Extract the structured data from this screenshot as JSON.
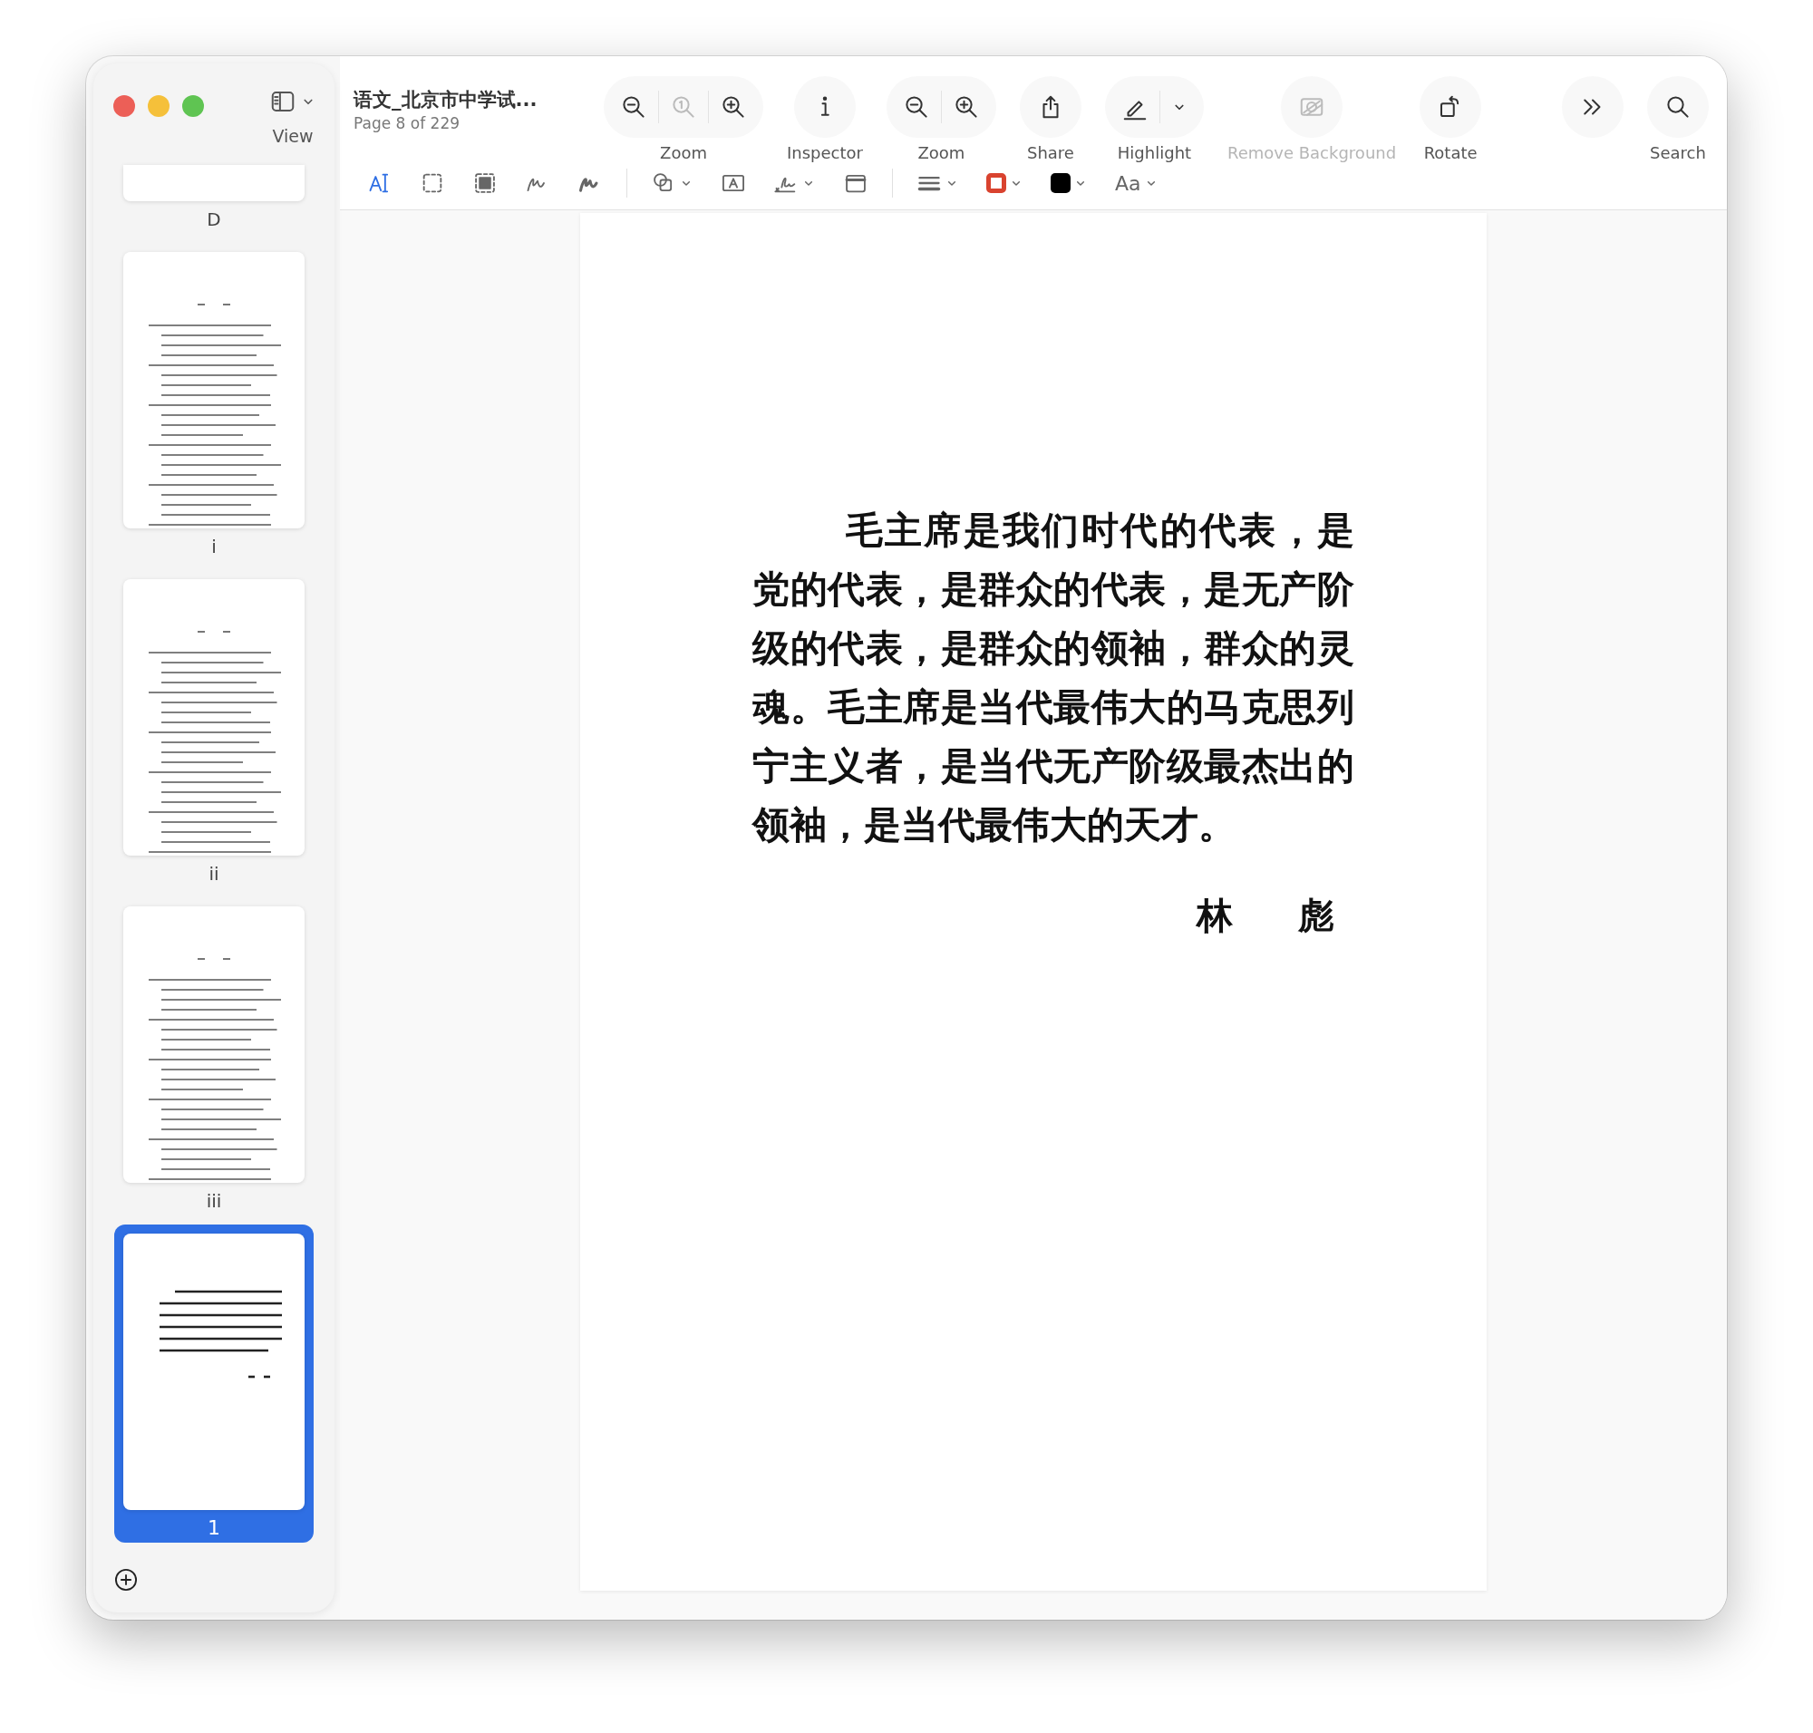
{
  "window": {
    "title": "语文_北京市中学试...",
    "subtitle": "Page 8 of 229",
    "view_label": "View"
  },
  "toolbar": [
    {
      "kind": "group",
      "label": "Zoom",
      "buttons": [
        {
          "kind": "zoom-out",
          "disabled": false
        },
        {
          "kind": "actual-size",
          "disabled": true
        },
        {
          "kind": "zoom-in",
          "disabled": false
        }
      ]
    },
    {
      "kind": "single",
      "label": "Inspector",
      "buttons": [
        {
          "kind": "info",
          "disabled": false
        }
      ]
    },
    {
      "kind": "group",
      "label": "Zoom",
      "buttons": [
        {
          "kind": "zoom-out",
          "disabled": false
        },
        {
          "kind": "zoom-in",
          "disabled": false
        }
      ]
    },
    {
      "kind": "single",
      "label": "Share",
      "buttons": [
        {
          "kind": "share",
          "disabled": false
        }
      ]
    },
    {
      "kind": "group",
      "label": "Highlight",
      "buttons": [
        {
          "kind": "highlight",
          "disabled": false
        },
        {
          "kind": "caret",
          "disabled": false
        }
      ]
    },
    {
      "kind": "single",
      "label": "Remove Background",
      "buttons": [
        {
          "kind": "remove-bg",
          "disabled": true
        }
      ]
    },
    {
      "kind": "single",
      "label": "Rotate",
      "buttons": [
        {
          "kind": "rotate",
          "disabled": false
        }
      ]
    },
    {
      "kind": "overflow",
      "buttons": [
        {
          "kind": "more",
          "disabled": false
        }
      ]
    },
    {
      "kind": "single",
      "label": "Search",
      "buttons": [
        {
          "kind": "search",
          "disabled": false
        }
      ]
    }
  ],
  "markup_tools": [
    {
      "kind": "text-select",
      "selected": true
    },
    {
      "kind": "rect-select",
      "selected": false
    },
    {
      "kind": "redact",
      "selected": false
    },
    {
      "kind": "sketch",
      "selected": false
    },
    {
      "kind": "draw",
      "selected": false
    },
    {
      "kind": "shapes",
      "selected": false
    },
    {
      "kind": "text-box",
      "selected": false
    },
    {
      "kind": "sign",
      "selected": false
    },
    {
      "kind": "note",
      "selected": false
    },
    {
      "kind": "border-style",
      "selected": false
    },
    {
      "kind": "border-color",
      "selected": false,
      "color": "#d9432f"
    },
    {
      "kind": "fill-color",
      "selected": false,
      "color": "#000000"
    },
    {
      "kind": "font",
      "selected": false,
      "label": "Aa"
    }
  ],
  "sidebar": {
    "thumbnails": [
      {
        "label": "D",
        "kind": "cut",
        "selected": false
      },
      {
        "label": "i",
        "kind": "toc",
        "selected": false
      },
      {
        "label": "ii",
        "kind": "toc",
        "selected": false
      },
      {
        "label": "iii",
        "kind": "toc",
        "selected": false
      },
      {
        "label": "1",
        "kind": "quote",
        "selected": true
      }
    ]
  },
  "document": {
    "paragraph": "毛主席是我们时代的代表，是党的代表，是群众的代表，是无产阶级的代表，是群众的领袖，群众的灵魂。毛主席是当代最伟大的马克思列宁主义者，是当代无产阶级最杰出的领袖，是当代最伟大的天才。",
    "signature": "林　彪"
  }
}
